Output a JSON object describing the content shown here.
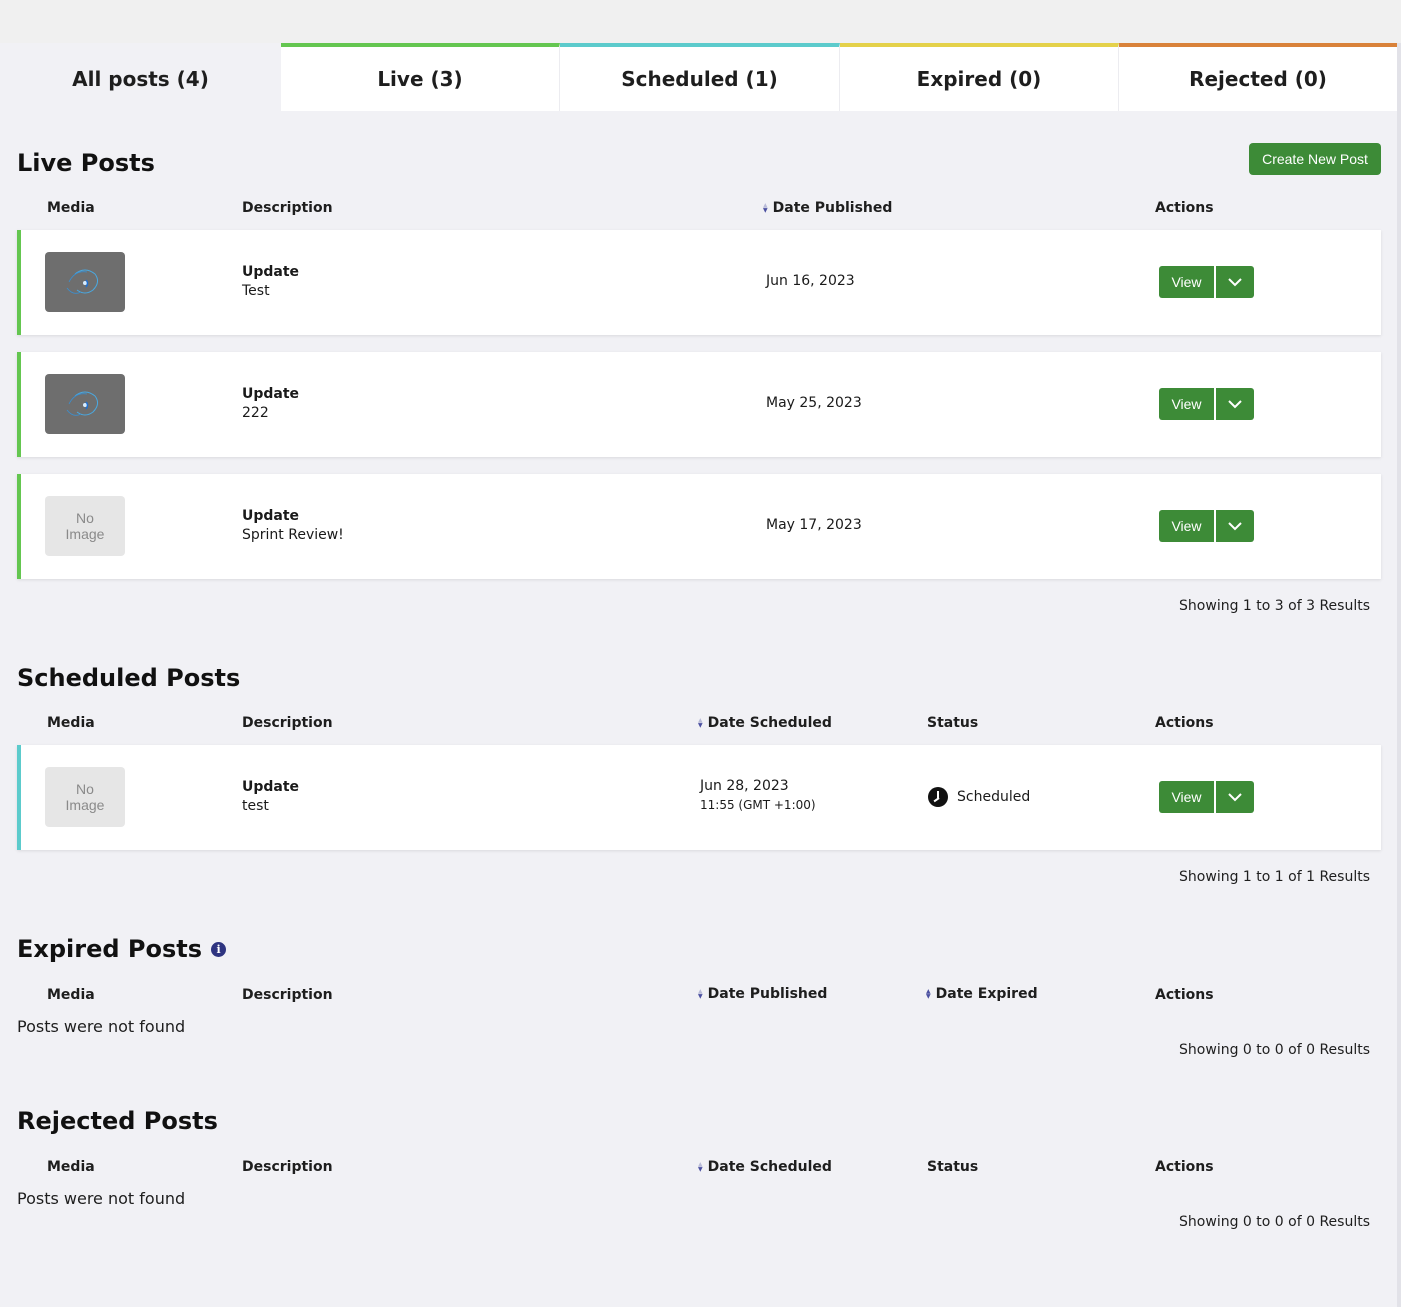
{
  "tabs": [
    {
      "label": "All posts (4)",
      "color": "#f1f1f5"
    },
    {
      "label": "Live (3)",
      "color": "#64c650"
    },
    {
      "label": "Scheduled (1)",
      "color": "#5ccbcc"
    },
    {
      "label": "Expired (0)",
      "color": "#e4d14a"
    },
    {
      "label": "Rejected (0)",
      "color": "#d9823a"
    }
  ],
  "create_button": "Create New Post",
  "live": {
    "title": "Live Posts",
    "headers": {
      "media": "Media",
      "description": "Description",
      "date": "Date Published",
      "actions": "Actions"
    },
    "accent": "#64c650",
    "rows": [
      {
        "media": "image",
        "title": "Update",
        "text": "Test",
        "date": "Jun 16, 2023",
        "view": "View"
      },
      {
        "media": "image",
        "title": "Update",
        "text": "222",
        "date": "May 25, 2023",
        "view": "View"
      },
      {
        "media": "none",
        "no_image_1": "No",
        "no_image_2": "Image",
        "title": "Update",
        "text": "Sprint Review!",
        "date": "May 17, 2023",
        "view": "View"
      }
    ],
    "showing": "Showing 1 to 3 of 3 Results"
  },
  "scheduled": {
    "title": "Scheduled Posts",
    "headers": {
      "media": "Media",
      "description": "Description",
      "date": "Date Scheduled",
      "status": "Status",
      "actions": "Actions"
    },
    "accent": "#5ccbcc",
    "rows": [
      {
        "no_image_1": "No",
        "no_image_2": "Image",
        "title": "Update",
        "text": "test",
        "date": "Jun 28, 2023",
        "time": "11:55 (GMT +1:00)",
        "status": "Scheduled",
        "view": "View"
      }
    ],
    "showing": "Showing 1 to 1 of 1 Results"
  },
  "expired": {
    "title": "Expired Posts",
    "info_icon": "i",
    "headers": {
      "media": "Media",
      "description": "Description",
      "date_published": "Date Published",
      "date_expired": "Date Expired",
      "actions": "Actions"
    },
    "empty": "Posts were not found",
    "showing": "Showing 0 to 0 of 0 Results"
  },
  "rejected": {
    "title": "Rejected Posts",
    "headers": {
      "media": "Media",
      "description": "Description",
      "date": "Date Scheduled",
      "status": "Status",
      "actions": "Actions"
    },
    "empty": "Posts were not found",
    "showing": "Showing 0 to 0 of 0 Results"
  }
}
